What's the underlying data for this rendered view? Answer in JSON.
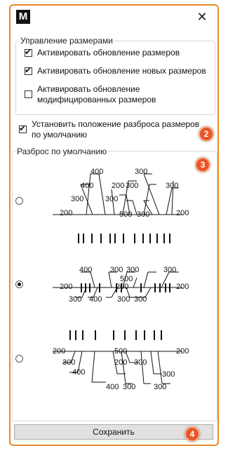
{
  "window": {
    "app_icon_letter": "M",
    "close_icon": "close-icon"
  },
  "size_management": {
    "title": "Управление размерами",
    "items": [
      {
        "label": "Активировать обновление размеров",
        "checked": true
      },
      {
        "label": "Активировать обновление новых размеров",
        "checked": true
      },
      {
        "label_line1": "Активировать обновление",
        "label_line2": "модифицированных размеров",
        "checked": false
      }
    ]
  },
  "default_position": {
    "label_line1": "Установить положение разброса размеров",
    "label_line2": "по умолчанию",
    "checked": true
  },
  "default_spread": {
    "title": "Разброс по умолчанию",
    "options": [
      {
        "selected": false,
        "labels": [
          "400",
          "400",
          "200",
          "300",
          "300",
          "300",
          "300",
          "300",
          "300",
          "500",
          "200",
          "200"
        ]
      },
      {
        "selected": true,
        "labels": [
          "400",
          "200",
          "300",
          "300",
          "300",
          "500",
          "200",
          "200",
          "300",
          "400",
          "300",
          "300"
        ]
      },
      {
        "selected": false,
        "labels": [
          "200",
          "300",
          "400",
          "500",
          "200",
          "200",
          "300",
          "400",
          "300",
          "300",
          "300"
        ]
      }
    ]
  },
  "save_button": {
    "label": "Сохранить"
  },
  "badges": [
    "2",
    "3",
    "4"
  ],
  "colors": {
    "accent": "#e88a2a",
    "badge": "#e8562a"
  }
}
